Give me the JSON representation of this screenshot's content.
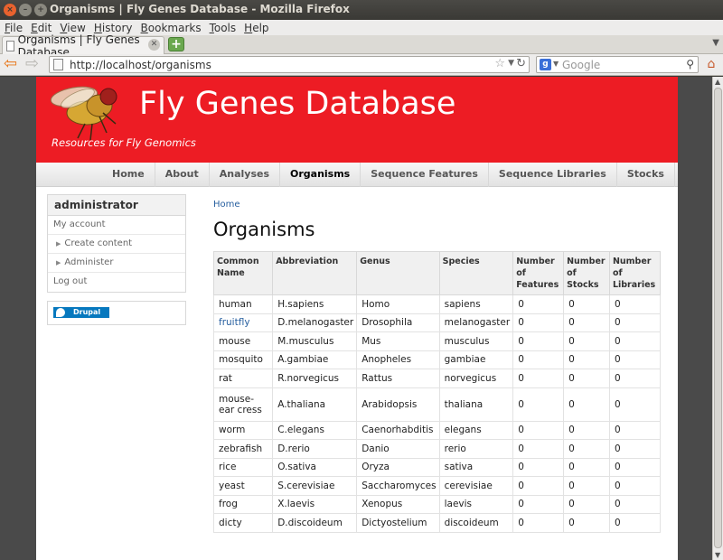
{
  "window": {
    "title": "Organisms | Fly Genes Database - Mozilla Firefox"
  },
  "menubar": [
    {
      "label": "File",
      "u": "F",
      "rest": "ile"
    },
    {
      "label": "Edit",
      "u": "E",
      "rest": "dit"
    },
    {
      "label": "View",
      "u": "V",
      "rest": "iew"
    },
    {
      "label": "History",
      "u": "H",
      "rest": "istory"
    },
    {
      "label": "Bookmarks",
      "u": "B",
      "rest": "ookmarks"
    },
    {
      "label": "Tools",
      "u": "T",
      "rest": "ools"
    },
    {
      "label": "Help",
      "u": "H",
      "rest": "elp"
    }
  ],
  "tab": {
    "title": "Organisms | Fly Genes Database"
  },
  "navbar": {
    "url": "http://localhost/organisms",
    "search_placeholder": "Google"
  },
  "site": {
    "name": "Fly Genes Database",
    "slogan": "Resources for Fly Genomics",
    "header_color": "#ed1c24"
  },
  "primary_nav": [
    {
      "label": "Home",
      "active": false
    },
    {
      "label": "About",
      "active": false
    },
    {
      "label": "Analyses",
      "active": false
    },
    {
      "label": "Organisms",
      "active": true
    },
    {
      "label": "Sequence Features",
      "active": false
    },
    {
      "label": "Sequence Libraries",
      "active": false
    },
    {
      "label": "Stocks",
      "active": false
    }
  ],
  "user_block": {
    "title": "administrator",
    "links": [
      {
        "label": "My account",
        "sub": false
      },
      {
        "label": "Create content",
        "sub": true
      },
      {
        "label": "Administer",
        "sub": true
      },
      {
        "label": "Log out",
        "sub": false
      }
    ]
  },
  "drupal_badge": "Drupal",
  "breadcrumb": "Home",
  "page_title": "Organisms",
  "table": {
    "headers": [
      "Common\nName",
      "Abbreviation",
      "Genus",
      "Species",
      "Number of\nFeatures",
      "Number\nof Stocks",
      "Number of\nLibraries"
    ],
    "rows": [
      [
        "human",
        "H.sapiens",
        "Homo",
        "sapiens",
        "0",
        "0",
        "0"
      ],
      [
        "fruitfly",
        "D.melanogaster",
        "Drosophila",
        "melanogaster",
        "0",
        "0",
        "0"
      ],
      [
        "mouse",
        "M.musculus",
        "Mus",
        "musculus",
        "0",
        "0",
        "0"
      ],
      [
        "mosquito",
        "A.gambiae",
        "Anopheles",
        "gambiae",
        "0",
        "0",
        "0"
      ],
      [
        "rat",
        "R.norvegicus",
        "Rattus",
        "norvegicus",
        "0",
        "0",
        "0"
      ],
      [
        "mouse-ear cress",
        "A.thaliana",
        "Arabidopsis",
        "thaliana",
        "0",
        "0",
        "0"
      ],
      [
        "worm",
        "C.elegans",
        "Caenorhabditis",
        "elegans",
        "0",
        "0",
        "0"
      ],
      [
        "zebrafish",
        "D.rerio",
        "Danio",
        "rerio",
        "0",
        "0",
        "0"
      ],
      [
        "rice",
        "O.sativa",
        "Oryza",
        "sativa",
        "0",
        "0",
        "0"
      ],
      [
        "yeast",
        "S.cerevisiae",
        "Saccharomyces",
        "cerevisiae",
        "0",
        "0",
        "0"
      ],
      [
        "frog",
        "X.laevis",
        "Xenopus",
        "laevis",
        "0",
        "0",
        "0"
      ],
      [
        "dicty",
        "D.discoideum",
        "Dictyostelium",
        "discoideum",
        "0",
        "0",
        "0"
      ]
    ],
    "linked_rows": [
      1
    ]
  }
}
